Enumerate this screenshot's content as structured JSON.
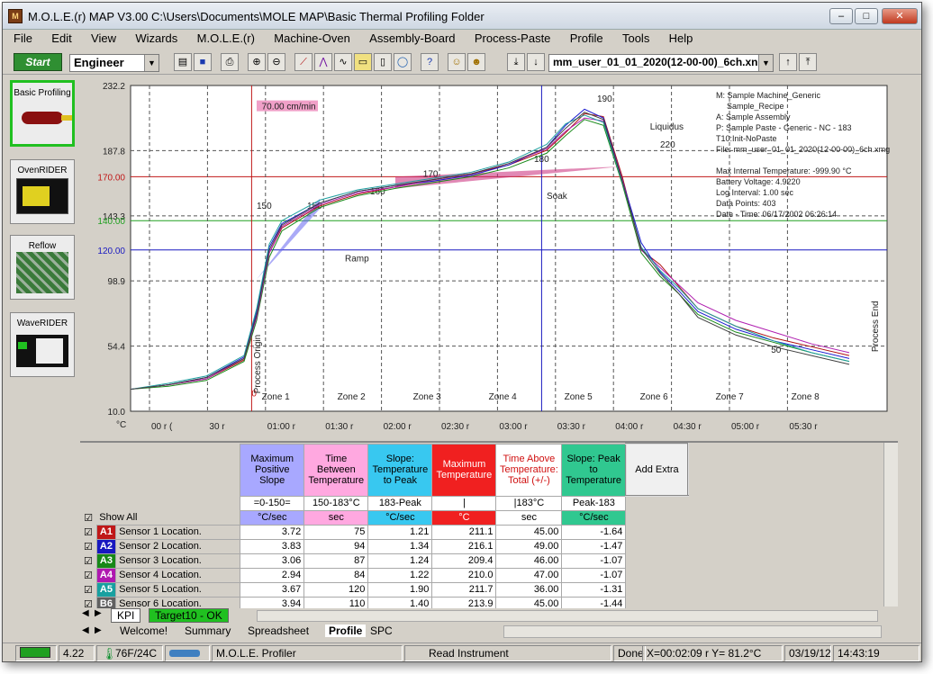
{
  "window": {
    "title": "M.O.L.E.(r) MAP V3.00   C:\\Users\\Documents\\MOLE MAP\\Basic Thermal Profiling Folder",
    "icon": "mole-app-icon"
  },
  "menu": [
    "File",
    "Edit",
    "View",
    "Wizards",
    "M.O.L.E.(r)",
    "Machine-Oven",
    "Assembly-Board",
    "Process-Paste",
    "Profile",
    "Tools",
    "Help"
  ],
  "toolbar": {
    "start_label": "Start",
    "user_level": "Engineer",
    "file_select": "mm_user_01_01_2020(12-00-00)_6ch.xn"
  },
  "sidebar": [
    {
      "label": "Basic Profiling"
    },
    {
      "label": "OvenRIDER"
    },
    {
      "label": "Reflow"
    },
    {
      "label": "WaveRIDER"
    }
  ],
  "chart": {
    "y_ticks": [
      "232.2",
      "187.8",
      "170.00",
      "143.3",
      "140.00",
      "120.00",
      "98.9",
      "54.4",
      "10.0"
    ],
    "y_unit": "°C",
    "x_ticks": [
      "00 r (",
      "30 r",
      "01:00 r",
      "01:30 r",
      "02:00 r",
      "02:30 r",
      "03:00 r",
      "03:30 r",
      "04:00 r",
      "04:30 r",
      "05:00 r",
      "05:30 r"
    ],
    "zones": [
      "Zone 1",
      "Zone 2",
      "Zone 3",
      "Zone 4",
      "Zone 5",
      "Zone 6",
      "Zone 7",
      "Zone 8"
    ],
    "speed": "70.00 cm/min",
    "labels": {
      "process_origin": "Process Origin",
      "process_end": "Process End",
      "ramp": "Ramp",
      "soak": "Soak",
      "liquidus": "Liquidus",
      "zero": "0"
    },
    "limit_labels": [
      "150",
      "150",
      "160",
      "170",
      "180",
      "190",
      "220",
      "50"
    ],
    "info": [
      "M: Sample Machine_Generic",
      "Sample_Recipe",
      "A: Sample Assembly",
      "P: Sample Paste - Generic - NC - 183",
      "T10:Init-NoPaste",
      "File: mm_user_01_01_2020(12-00-00)_6ch.xmg",
      "",
      "Max Internal Temperature: -999.90 °C",
      "Battery Voltage: 4.9220",
      "Log Interval: 1.00 sec",
      "Data Points: 403",
      "Date - Time: 06/17/2002 06:26:14"
    ]
  },
  "chart_data": {
    "type": "line",
    "ylabel": "°C",
    "ylim": [
      10.0,
      232.2
    ],
    "x": [
      0,
      30,
      60,
      90,
      100,
      110,
      120,
      150,
      180,
      210,
      240,
      270,
      300,
      330,
      345,
      360,
      375,
      390,
      405,
      420,
      435,
      450,
      480,
      510,
      540,
      570
    ],
    "series": [
      {
        "name": "Sensor 1 Location.",
        "color": "#b01010",
        "values": [
          25,
          28,
          32,
          45,
          75,
          118,
          135,
          150,
          158,
          163,
          168,
          172,
          178,
          188,
          200,
          213,
          211,
          170,
          120,
          110,
          95,
          80,
          68,
          60,
          54,
          48
        ]
      },
      {
        "name": "Sensor 2 Location.",
        "color": "#1a1ad0",
        "values": [
          25,
          28,
          33,
          47,
          78,
          122,
          138,
          152,
          160,
          164,
          167,
          171,
          178,
          190,
          205,
          216,
          210,
          168,
          125,
          105,
          92,
          78,
          66,
          58,
          52,
          46
        ]
      },
      {
        "name": "Sensor 3 Location.",
        "color": "#1a8a1a",
        "values": [
          25,
          27,
          31,
          44,
          72,
          115,
          133,
          149,
          157,
          162,
          166,
          170,
          176,
          186,
          198,
          209,
          205,
          165,
          118,
          102,
          90,
          76,
          64,
          57,
          50,
          44
        ]
      },
      {
        "name": "Sensor 4 Location.",
        "color": "#b020b0",
        "values": [
          25,
          28,
          32,
          46,
          74,
          118,
          136,
          151,
          159,
          163,
          168,
          172,
          179,
          189,
          201,
          210,
          208,
          168,
          120,
          108,
          96,
          84,
          72,
          64,
          56,
          50
        ]
      },
      {
        "name": "Sensor 5 Location.",
        "color": "#20a0a0",
        "values": [
          25,
          29,
          34,
          48,
          80,
          124,
          140,
          154,
          161,
          165,
          169,
          173,
          180,
          192,
          206,
          212,
          207,
          166,
          122,
          106,
          94,
          80,
          68,
          58,
          50,
          44
        ]
      },
      {
        "name": "Sensor 6 Location.",
        "color": "#404040",
        "values": [
          25,
          28,
          33,
          46,
          76,
          120,
          137,
          152,
          160,
          164,
          168,
          172,
          179,
          190,
          203,
          214,
          209,
          167,
          121,
          104,
          90,
          74,
          62,
          54,
          48,
          42
        ]
      }
    ]
  },
  "kpi": {
    "headers": [
      {
        "title": "Maximum Positive Slope",
        "range": "=0-150=",
        "unit": "°C/sec",
        "bg": "#a8a8ff"
      },
      {
        "title": "Time Between Temperature",
        "range": "150-183°C",
        "unit": "sec",
        "bg": "#ffa8e0"
      },
      {
        "title": "Slope: Temperature to Peak",
        "range": "183-Peak",
        "unit": "°C/sec",
        "bg": "#38c8f0"
      },
      {
        "title": "Maximum Temperature",
        "range": "|",
        "unit": "°C",
        "bg": "#f02020"
      },
      {
        "title": "Time Above Temperature: Total (+/-)",
        "range": "|183°C",
        "unit": "sec",
        "bg": "#ffffff"
      },
      {
        "title": "Slope: Peak to Temperature",
        "range": "Peak-183",
        "unit": "°C/sec",
        "bg": "#30c890"
      }
    ],
    "add_extra": "Add Extra",
    "show_all": "Show All",
    "rows": [
      {
        "id": "A1",
        "name": "Sensor 1 Location.",
        "color": "#c01818",
        "vals": [
          "3.72",
          "75",
          "1.21",
          "211.1",
          "45.00",
          "-1.64"
        ]
      },
      {
        "id": "A2",
        "name": "Sensor 2 Location.",
        "color": "#1818c0",
        "vals": [
          "3.83",
          "94",
          "1.34",
          "216.1",
          "49.00",
          "-1.47"
        ]
      },
      {
        "id": "A3",
        "name": "Sensor 3 Location.",
        "color": "#188818",
        "vals": [
          "3.06",
          "87",
          "1.24",
          "209.4",
          "46.00",
          "-1.07"
        ]
      },
      {
        "id": "A4",
        "name": "Sensor 4 Location.",
        "color": "#b018b0",
        "vals": [
          "2.94",
          "84",
          "1.22",
          "210.0",
          "47.00",
          "-1.07"
        ]
      },
      {
        "id": "A5",
        "name": "Sensor 5 Location.",
        "color": "#18a0a0",
        "vals": [
          "3.67",
          "120",
          "1.90",
          "211.7",
          "36.00",
          "-1.31"
        ]
      },
      {
        "id": "B6",
        "name": "Sensor 6 Location.",
        "color": "#606060",
        "vals": [
          "3.94",
          "110",
          "1.40",
          "213.9",
          "45.00",
          "-1.44"
        ]
      }
    ]
  },
  "tabs_lower": [
    "KPI",
    "Target10 - OK"
  ],
  "tabs_main": [
    "Welcome!",
    "Summary",
    "Spreadsheet",
    "Profile",
    "SPC"
  ],
  "status": {
    "battery": "4.22",
    "temp": "76F/24C",
    "profiler": "M.O.L.E. Profiler",
    "read": "Read Instrument",
    "done": "Done",
    "coords": "X=00:02:09 r Y=  81.2°C",
    "date": "03/19/12",
    "time": "14:43:19"
  }
}
